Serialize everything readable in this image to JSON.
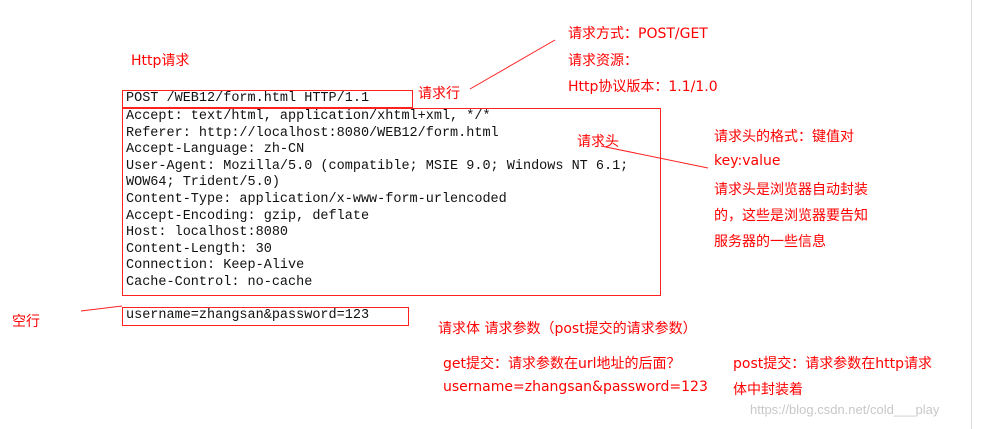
{
  "colors": {
    "annotation": "#ff0000",
    "box_border": "#ff2020",
    "code_text": "#111111",
    "watermark": "#c8c8c8"
  },
  "title": "Http请求",
  "request_line": {
    "text": "POST /WEB12/form.html HTTP/1.1",
    "label": "请求行"
  },
  "request_line_notes": [
    "请求方式：POST/GET",
    "请求资源：",
    "Http协议版本：1.1/1.0"
  ],
  "headers": {
    "label": "请求头",
    "lines": [
      "Accept: text/html, application/xhtml+xml, */*",
      "Referer: http://localhost:8080/WEB12/form.html",
      "Accept-Language: zh-CN",
      "User-Agent: Mozilla/5.0 (compatible; MSIE 9.0; Windows NT 6.1;",
      "WOW64; Trident/5.0)",
      "Content-Type: application/x-www-form-urlencoded",
      "Accept-Encoding: gzip, deflate",
      "Host: localhost:8080",
      "Content-Length: 30",
      "Connection: Keep-Alive",
      "Cache-Control: no-cache"
    ],
    "notes": [
      "请求头的格式：键值对",
      "key:value",
      "请求头是浏览器自动封装",
      "的，这些是浏览器要告知",
      "服务器的一些信息"
    ]
  },
  "empty_line_label": "空行",
  "body": {
    "text": "username=zhangsan&password=123",
    "label": "请求体  请求参数（post提交的请求参数）"
  },
  "get_note": [
    "get提交：请求参数在url地址的后面？",
    "username=zhangsan&password=123"
  ],
  "post_note": [
    "post提交：请求参数在http请求",
    "体中封装着"
  ],
  "watermark": "https://blog.csdn.net/cold___play"
}
